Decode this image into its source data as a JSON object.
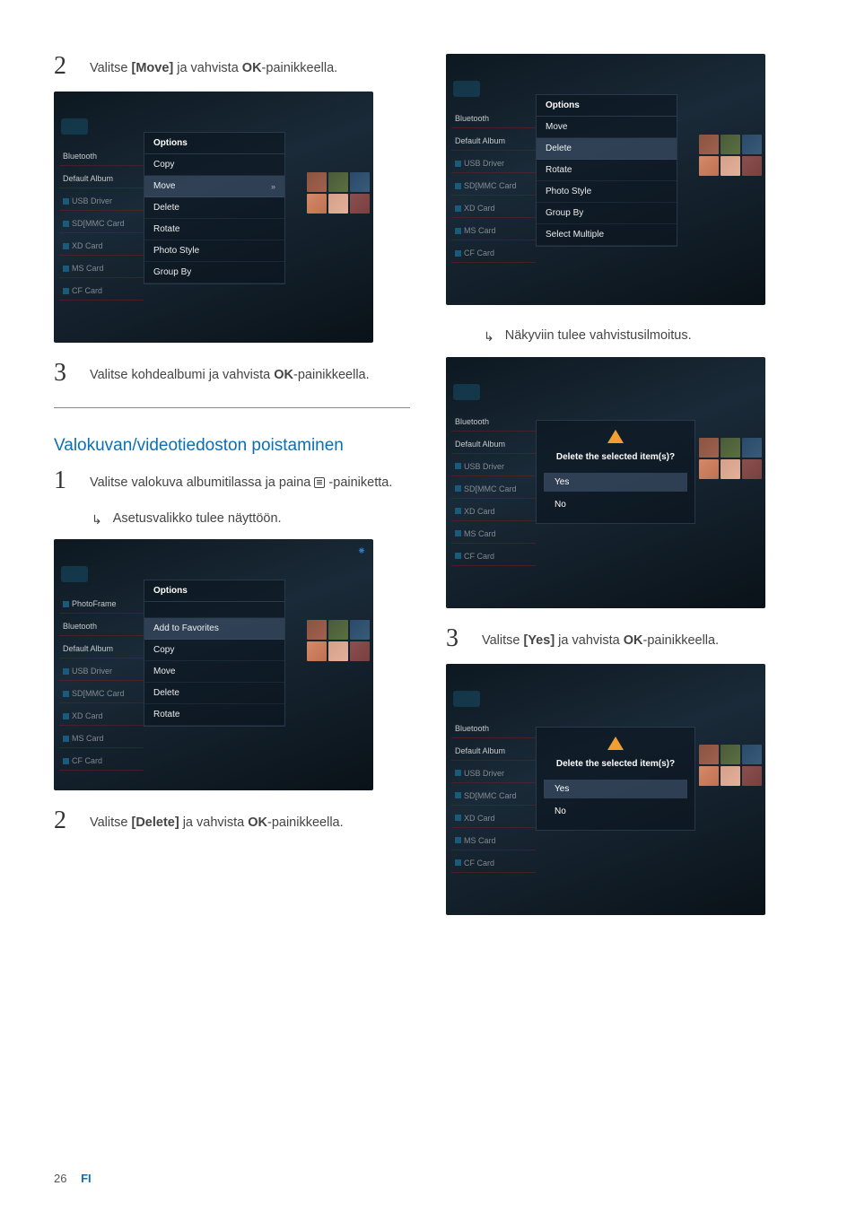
{
  "left": {
    "step2": {
      "num": "2",
      "pre": "Valitse ",
      "bold1": "[Move]",
      "mid": " ja vahvista ",
      "bold2": "OK",
      "post": "-painikkeella."
    },
    "screenshot_a": {
      "sidebar": [
        "Bluetooth",
        "Default Album",
        "USB Driver",
        "SD[MMC Card",
        "XD Card",
        "MS Card",
        "CF Card"
      ],
      "menu_header": "Options",
      "menu_items": [
        "Copy",
        "Move",
        "Delete",
        "Rotate",
        "Photo Style",
        "Group By"
      ],
      "highlighted_index": 1
    },
    "step3": {
      "num": "3",
      "pre": "Valitse kohdealbumi ja vahvista ",
      "bold1": "OK",
      "post": "-painikkeella."
    },
    "heading": "Valokuvan/videotiedoston poistaminen",
    "step1b": {
      "num": "1",
      "text": "Valitse valokuva albumitilassa ja paina ",
      "post": " -painiketta.",
      "sub": "Asetusvalikko tulee näyttöön."
    },
    "screenshot_b": {
      "sidebar": [
        "PhotoFrame",
        "Bluetooth",
        "Default Album",
        "USB Driver",
        "SD[MMC Card",
        "XD Card",
        "MS Card",
        "CF Card"
      ],
      "menu_header": "Options",
      "menu_items": [
        "Add to Favorites",
        "Copy",
        "Move",
        "Delete",
        "Rotate"
      ],
      "highlighted_index": 0
    },
    "step2b": {
      "num": "2",
      "pre": "Valitse ",
      "bold1": "[Delete]",
      "mid": " ja vahvista ",
      "bold2": "OK",
      "post": "-painikkeella."
    }
  },
  "right": {
    "screenshot_c": {
      "sidebar": [
        "Bluetooth",
        "Default Album",
        "USB Driver",
        "SD[MMC Card",
        "XD Card",
        "MS Card",
        "CF Card"
      ],
      "menu_header": "Options",
      "menu_items": [
        "Move",
        "Delete",
        "Rotate",
        "Photo Style",
        "Group By",
        "Select Multiple"
      ],
      "highlighted_index": 1
    },
    "sub_c": "Näkyviin tulee vahvistusilmoitus.",
    "screenshot_d": {
      "sidebar": [
        "Bluetooth",
        "Default Album",
        "USB Driver",
        "SD[MMC Card",
        "XD Card",
        "MS Card",
        "CF Card"
      ],
      "prompt": "Delete the selected item(s)?",
      "options": [
        "Yes",
        "No"
      ],
      "highlighted_index": 0
    },
    "step3b": {
      "num": "3",
      "pre": "Valitse ",
      "bold1": "[Yes]",
      "mid": " ja vahvista ",
      "bold2": "OK",
      "post": "-painikkeella."
    },
    "screenshot_e": {
      "sidebar": [
        "Bluetooth",
        "Default Album",
        "USB Driver",
        "SD[MMC Card",
        "XD Card",
        "MS Card",
        "CF Card"
      ],
      "prompt": "Delete the selected item(s)?",
      "options": [
        "Yes",
        "No"
      ],
      "highlighted_index": 0
    }
  },
  "footer": {
    "page": "26",
    "lang": "FI"
  }
}
